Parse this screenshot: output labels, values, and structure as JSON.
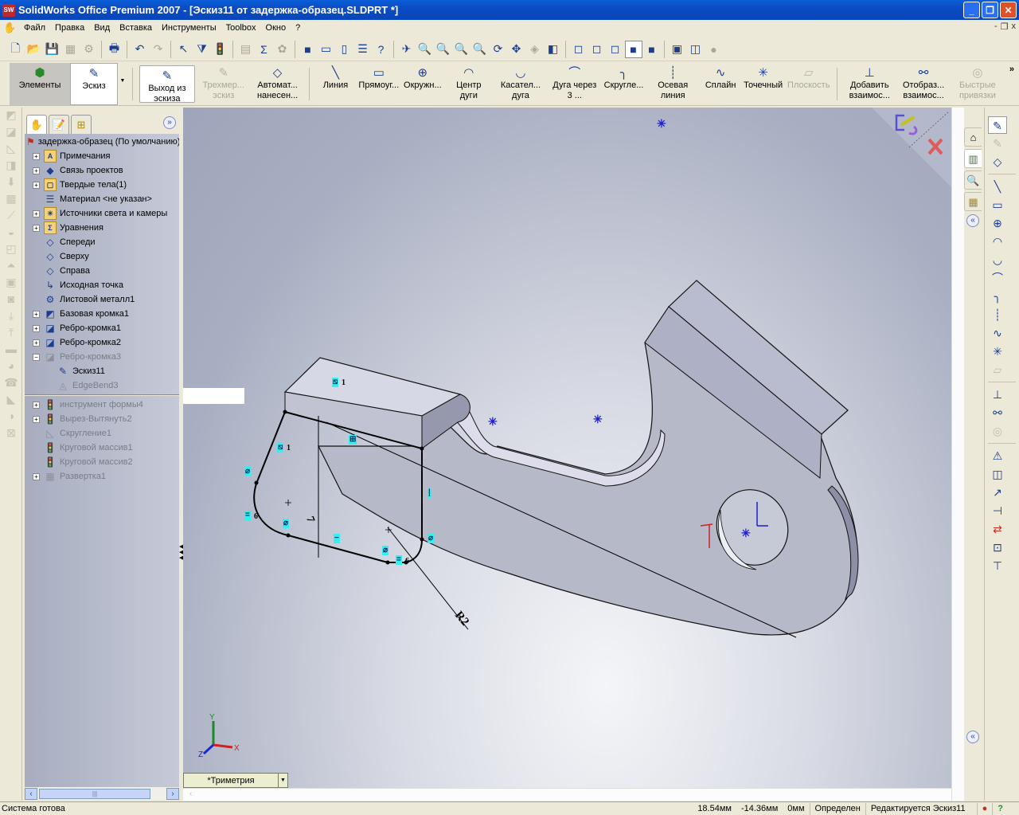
{
  "window": {
    "app_icon": "SW",
    "title": "SolidWorks Office Premium 2007 - [Эскиз11 от задержка-образец.SLDPRT *]",
    "buttons": {
      "minimize": "_",
      "restore": "❐",
      "close": "✕"
    }
  },
  "menubar": {
    "items": [
      "Файл",
      "Правка",
      "Вид",
      "Вставка",
      "Инструменты",
      "Toolbox",
      "Окно",
      "?"
    ],
    "doc_buttons": {
      "minimize": "-",
      "restore": "❐",
      "close": "x"
    }
  },
  "standard_toolbar": {
    "icons": [
      {
        "name": "new-document-icon",
        "glyph": "🗋"
      },
      {
        "name": "open-icon",
        "glyph": "📂"
      },
      {
        "name": "save-icon",
        "glyph": "💾"
      },
      {
        "name": "make-drawing-icon",
        "glyph": "▦",
        "dim": true
      },
      {
        "name": "make-assembly-icon",
        "glyph": "⚙",
        "dim": true
      },
      {
        "name": "print-icon",
        "glyph": "🖶"
      },
      {
        "name": "undo-icon",
        "glyph": "↶"
      },
      {
        "name": "redo-icon",
        "glyph": "↷",
        "dim": true
      },
      {
        "name": "select-icon",
        "glyph": "↖"
      },
      {
        "name": "selection-filter-icon",
        "glyph": "⧩"
      },
      {
        "name": "rebuild-icon",
        "glyph": "🚦"
      },
      {
        "name": "file-properties-icon",
        "glyph": "▤",
        "dim": true
      },
      {
        "name": "options-icon",
        "glyph": "Σ"
      },
      {
        "name": "photoworks-icon",
        "glyph": "✿",
        "dim": true
      },
      {
        "name": "solidworks-resources-icon",
        "glyph": "■"
      },
      {
        "name": "layout-icon",
        "glyph": "▭"
      },
      {
        "name": "single-view-icon",
        "glyph": "▯"
      },
      {
        "name": "properties-list-icon",
        "glyph": "☰"
      },
      {
        "name": "help-icon",
        "glyph": "?"
      },
      {
        "name": "previous-view-icon",
        "glyph": "✈"
      },
      {
        "name": "zoom-to-fit-icon",
        "glyph": "🔍"
      },
      {
        "name": "zoom-to-area-icon",
        "glyph": "🔍"
      },
      {
        "name": "zoom-in-out-icon",
        "glyph": "🔍"
      },
      {
        "name": "zoom-to-selection-icon",
        "glyph": "🔍"
      },
      {
        "name": "rotate-view-icon",
        "glyph": "⟳"
      },
      {
        "name": "pan-icon",
        "glyph": "✥"
      },
      {
        "name": "3d-drawing-view-icon",
        "glyph": "◈",
        "dim": true
      },
      {
        "name": "standard-views-icon",
        "glyph": "◧"
      },
      {
        "name": "wireframe-icon",
        "glyph": "◻"
      },
      {
        "name": "hidden-lines-visible-icon",
        "glyph": "◻"
      },
      {
        "name": "hidden-lines-removed-icon",
        "glyph": "◻"
      },
      {
        "name": "shaded-with-edges-icon",
        "glyph": "■",
        "pressed": true
      },
      {
        "name": "shaded-icon",
        "glyph": "■"
      },
      {
        "name": "shadows-icon",
        "glyph": "▣"
      },
      {
        "name": "section-view-icon",
        "glyph": "◫"
      },
      {
        "name": "realview-icon",
        "glyph": "●",
        "dim": true
      }
    ]
  },
  "command_manager": {
    "tabs": [
      {
        "label": "Элементы",
        "icon": "features-icon"
      },
      {
        "label": "Эскиз",
        "icon": "sketch-icon"
      }
    ],
    "buttons": [
      {
        "id": "exit-sketch",
        "label": "Выход из эскиза",
        "glyph": "✎",
        "boxed": true
      },
      {
        "id": "3d-sketch",
        "label": "Трехмер... эскиз",
        "glyph": "✎",
        "dim": true
      },
      {
        "id": "smart-dimension",
        "label": "Автомат... нанесен...",
        "glyph": "◇"
      },
      {
        "id": "line",
        "label": "Линия",
        "glyph": "╲",
        "sep_before": true
      },
      {
        "id": "rectangle",
        "label": "Прямоуг...",
        "glyph": "▭"
      },
      {
        "id": "circle",
        "label": "Окружн...",
        "glyph": "⊕"
      },
      {
        "id": "centerpoint-arc",
        "label": "Центр дуги",
        "glyph": "◠"
      },
      {
        "id": "tangent-arc",
        "label": "Касател... дуга",
        "glyph": "◡"
      },
      {
        "id": "3-point-arc",
        "label": "Дуга через 3 ...",
        "glyph": "⌒"
      },
      {
        "id": "sketch-fillet",
        "label": "Скругле...",
        "glyph": "╮"
      },
      {
        "id": "centerline",
        "label": "Осевая линия",
        "glyph": "┊"
      },
      {
        "id": "spline",
        "label": "Сплайн",
        "glyph": "∿"
      },
      {
        "id": "point",
        "label": "Точечный",
        "glyph": "✳"
      },
      {
        "id": "plane",
        "label": "Плоскость",
        "glyph": "▱",
        "dim": true
      },
      {
        "id": "add-relation",
        "label": "Добавить взаимос...",
        "glyph": "⊥",
        "sep_before": true
      },
      {
        "id": "display-relations",
        "label": "Отобраз... взаимос...",
        "glyph": "⚯"
      },
      {
        "id": "quick-snaps",
        "label": "Быстрые привязки",
        "glyph": "◎",
        "dim": true
      }
    ],
    "overflow": "»"
  },
  "feature_manager": {
    "tabs": [
      "feature-tree",
      "property-manager",
      "configuration-manager"
    ],
    "expand": "»",
    "root": "задержка-образец  (По умолчанию)",
    "items": [
      {
        "label": "Примечания",
        "expander": "+",
        "icon": "annotations-icon",
        "glyph": "A",
        "folder": true
      },
      {
        "label": "Связь проектов",
        "expander": "+",
        "icon": "design-binder-icon",
        "glyph": "◆"
      },
      {
        "label": "Твердые тела(1)",
        "expander": "+",
        "icon": "solid-bodies-icon",
        "glyph": "▢",
        "folder": true
      },
      {
        "label": "Материал <не указан>",
        "expander": "",
        "icon": "material-icon",
        "glyph": "☰"
      },
      {
        "label": "Источники света и камеры",
        "expander": "+",
        "icon": "lights-icon",
        "glyph": "☀",
        "folder": true
      },
      {
        "label": "Уравнения",
        "expander": "+",
        "icon": "equations-icon",
        "glyph": "Σ",
        "folder": true
      },
      {
        "label": "Спереди",
        "expander": "",
        "icon": "plane-icon",
        "glyph": "◇"
      },
      {
        "label": "Сверху",
        "expander": "",
        "icon": "plane-icon",
        "glyph": "◇"
      },
      {
        "label": "Справа",
        "expander": "",
        "icon": "plane-icon",
        "glyph": "◇"
      },
      {
        "label": "Исходная точка",
        "expander": "",
        "icon": "origin-icon",
        "glyph": "↳"
      },
      {
        "label": "Листовой металл1",
        "expander": "",
        "icon": "sheet-metal-icon",
        "glyph": "⚙"
      },
      {
        "label": "Базовая кромка1",
        "expander": "+",
        "icon": "base-flange-icon",
        "glyph": "◩"
      },
      {
        "label": "Ребро-кромка1",
        "expander": "+",
        "icon": "edge-flange-icon",
        "glyph": "◪"
      },
      {
        "label": "Ребро-кромка2",
        "expander": "+",
        "icon": "edge-flange-icon",
        "glyph": "◪"
      },
      {
        "label": "Ребро-кромка3",
        "expander": "−",
        "icon": "edge-flange-icon",
        "glyph": "◪",
        "dim": true
      },
      {
        "label": "Эскиз11",
        "expander": "",
        "icon": "sketch-icon",
        "glyph": "✎",
        "indent": true
      },
      {
        "label": "EdgeBend3",
        "expander": "",
        "icon": "edge-bend-icon",
        "glyph": "◬",
        "indent": true,
        "dim": true
      }
    ],
    "suppressed_items": [
      {
        "label": "инструмент формы4",
        "expander": "+",
        "icon": "forming-tool-icon",
        "glyph": "🚦"
      },
      {
        "label": "Вырез-Вытянуть2",
        "expander": "+",
        "icon": "extruded-cut-icon",
        "glyph": "🚦"
      },
      {
        "label": "Скругление1",
        "expander": "",
        "icon": "fillet-icon",
        "glyph": "◺"
      },
      {
        "label": "Круговой массив1",
        "expander": "",
        "icon": "circular-pattern-icon",
        "glyph": "🚦"
      },
      {
        "label": "Круговой массив2",
        "expander": "",
        "icon": "circular-pattern-icon",
        "glyph": "🚦"
      },
      {
        "label": "Развертка1",
        "expander": "+",
        "icon": "flatten-icon",
        "glyph": "▦"
      }
    ]
  },
  "sheetmetal_toolbar": {
    "icons": [
      "base-flange-icon",
      "convert-to-sheet-metal-icon",
      "lofted-bend-icon",
      "edge-flange-icon",
      "miter-flange-icon",
      "hem-icon",
      "jog-icon",
      "sketched-bend-icon",
      "cross-break-icon",
      "closed-corner-icon",
      "welded-corner-icon",
      "break-corner-icon",
      "unfold-icon",
      "fold-icon",
      "flatten-icon",
      "no-bends-icon",
      "insert-bends-icon",
      "rip-icon",
      "forming-tool-icon",
      "vent-icon"
    ]
  },
  "viewport": {
    "view_orientation": "*Триметрия",
    "dimension_vertical": "7",
    "dimension_radius": "R2",
    "relation_labels": {
      "parallel_top": "1",
      "parallel_left": "1",
      "equal_left": "6",
      "equal_bottom": "6"
    },
    "triad": {
      "x": "X",
      "y": "Y",
      "z": "Z"
    },
    "confirm_corner": {
      "exit_sketch": "exit-sketch",
      "cancel": "cancel"
    }
  },
  "task_pane": {
    "tabs": [
      "solidworks-resources-icon",
      "design-library-icon",
      "file-explorer-icon",
      "view-palette-icon"
    ],
    "collapse": "«"
  },
  "sketch_toolbar_right": {
    "icons": [
      "exit-sketch-icon",
      "3d-sketch-icon",
      "smart-dimension-icon",
      "line-icon",
      "rectangle-icon",
      "circle-icon",
      "centerpoint-arc-icon",
      "tangent-arc-icon",
      "3-point-arc-icon",
      "sketch-fillet-icon",
      "centerline-icon",
      "spline-icon",
      "point-icon",
      "plane-icon",
      "add-relation-icon",
      "display-relations-icon",
      "quick-snaps-icon",
      "mirror-entities-icon",
      "offset-entities-icon",
      "convert-entities-icon",
      "trim-entities-icon",
      "move-entities-icon",
      "construction-geometry-icon",
      "modify-sketch-icon"
    ]
  },
  "status_bar": {
    "message": "Система готова",
    "x": "18.54мм",
    "y": "-14.36мм",
    "z": "0мм",
    "state": "Определен",
    "editing": "Редактируется Эскиз11",
    "rebuild_icon": "rebuild-icon",
    "help": "?"
  },
  "colors": {
    "titlebar": "#0b4bc4",
    "relation_badge": "#33f0f0",
    "sketch_line": "#000000",
    "point_blue": "#1e1ecc",
    "triad_x": "#d02020",
    "triad_y": "#1a8a2a",
    "triad_z": "#1a2ad0"
  }
}
